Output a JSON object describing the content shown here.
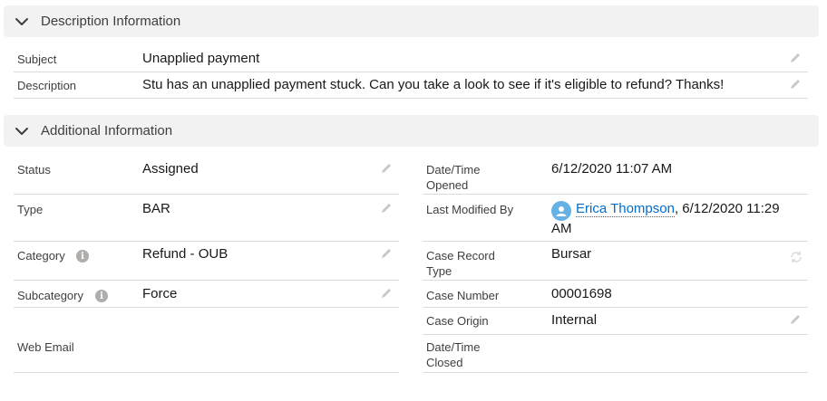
{
  "description_section": {
    "title": "Description Information",
    "subject_label": "Subject",
    "subject_value": "Unapplied payment",
    "description_label": "Description",
    "description_value": "Stu has an unapplied payment stuck. Can you take a look to see if it's eligible to refund? Thanks!"
  },
  "additional_section": {
    "title": "Additional Information",
    "left": {
      "status_label": "Status",
      "status_value": "Assigned",
      "type_label": "Type",
      "type_value": "BAR",
      "category_label": "Category",
      "category_value": "Refund - OUB",
      "subcategory_label": "Subcategory",
      "subcategory_value": "Force",
      "web_email_label": "Web Email",
      "web_email_value": ""
    },
    "right": {
      "opened_label_1": "Date/Time",
      "opened_label_2": "Opened",
      "opened_value": "6/12/2020 11:07 AM",
      "modified_label": "Last Modified By",
      "modified_user": "Erica Thompson",
      "modified_date_1": ", 6/12/2020 11:29",
      "modified_date_2": "AM",
      "record_type_label_1": "Case Record",
      "record_type_label_2": "Type",
      "record_type_value": "Bursar",
      "case_number_label": "Case Number",
      "case_number_value": "00001698",
      "origin_label": "Case Origin",
      "origin_value": "Internal",
      "closed_label_1": "Date/Time",
      "closed_label_2": "Closed",
      "closed_value": ""
    }
  },
  "icons": {
    "chevron": "chevron-down-icon",
    "edit": "pencil-icon",
    "info": "info-icon",
    "avatar": "user-avatar-icon",
    "readonly": "lock-icon"
  },
  "colors": {
    "header_bg": "#f3f2f2",
    "link": "#006dcc",
    "avatar": "#65b1e6",
    "divider": "#dddbda"
  }
}
